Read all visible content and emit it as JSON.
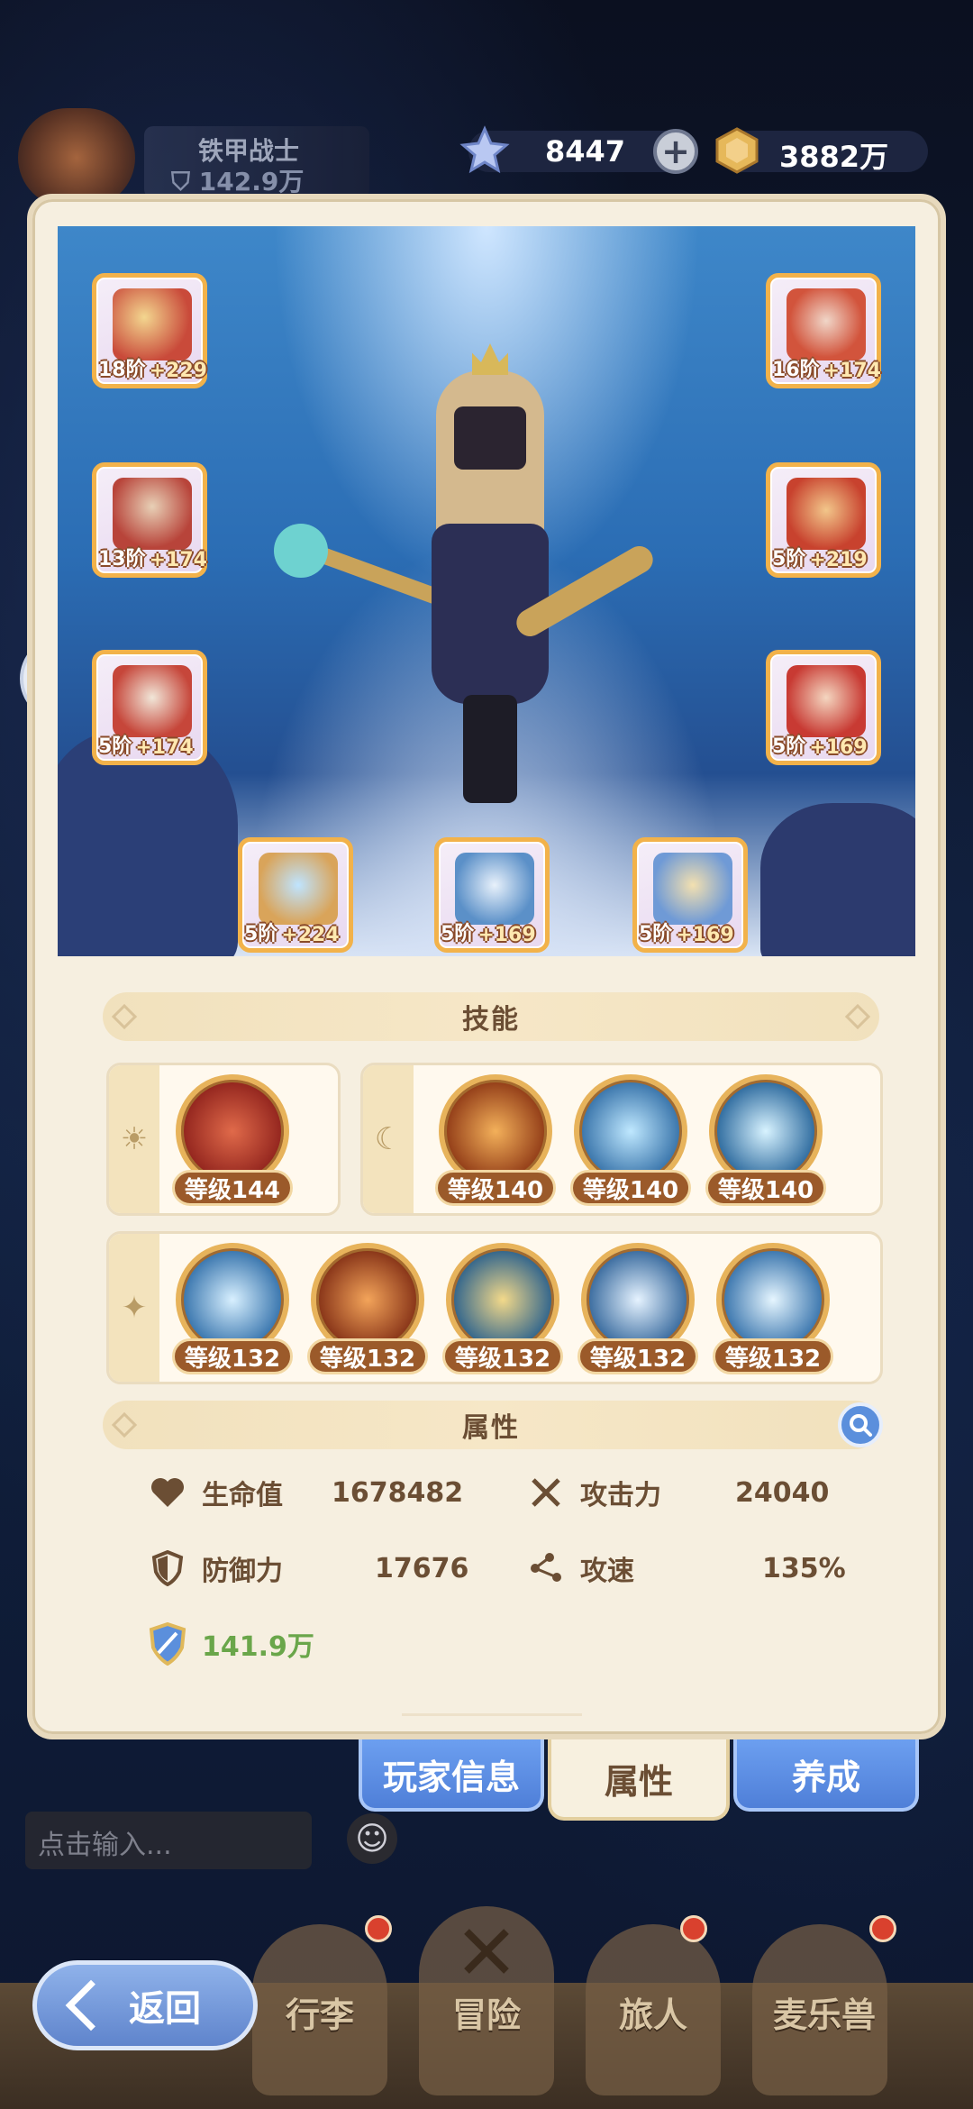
{
  "hud": {
    "player_name": "铁甲战士",
    "player_power": "142.9万",
    "star_currency": "8447",
    "coin_currency": "3882万"
  },
  "equipment": [
    {
      "id": "bow",
      "tier": "18阶",
      "bonus": "+229",
      "color": "#c94a3a"
    },
    {
      "id": "helmet",
      "tier": "16阶",
      "bonus": "+174",
      "color": "#d2543c"
    },
    {
      "id": "chest-armor",
      "tier": "13阶",
      "bonus": "+174",
      "color": "#b8443a"
    },
    {
      "id": "gauntlet",
      "tier": "5阶",
      "bonus": "+219",
      "color": "#c8422e"
    },
    {
      "id": "leg-armor",
      "tier": "5阶",
      "bonus": "+174",
      "color": "#c6463a"
    },
    {
      "id": "boots",
      "tier": "5阶",
      "bonus": "+169",
      "color": "#c83a33"
    },
    {
      "id": "ring",
      "tier": "5阶",
      "bonus": "+224",
      "color": "#5aa8e0"
    },
    {
      "id": "necklace",
      "tier": "5阶",
      "bonus": "+169",
      "color": "#5b90c8"
    },
    {
      "id": "charm",
      "tier": "5阶",
      "bonus": "+169",
      "color": "#6f9ad6"
    }
  ],
  "skills": {
    "header": "技能",
    "day_group": [
      {
        "name": "sun-archer-skill-icon",
        "level": "等级144",
        "color": "#c0392b"
      }
    ],
    "night_group": [
      {
        "name": "burst-skill-icon",
        "level": "等级140",
        "color": "#c0581e"
      },
      {
        "name": "target-hands-skill-icon",
        "level": "等级140",
        "color": "#d6a24a"
      },
      {
        "name": "comet-skill-icon",
        "level": "等级140",
        "color": "#2f8fc9"
      }
    ],
    "star_group": [
      {
        "name": "beast-skill-icon",
        "level": "等级132",
        "color": "#2f8fc9"
      },
      {
        "name": "fire-bow-skill-icon",
        "level": "等级132",
        "color": "#c0581e"
      },
      {
        "name": "castle-skill-icon",
        "level": "等级132",
        "color": "#2f7fb8"
      },
      {
        "name": "arrow-skill-icon",
        "level": "等级132",
        "color": "#3a7fc0"
      },
      {
        "name": "triple-arrow-skill-icon",
        "level": "等级132",
        "color": "#2f8fc9"
      }
    ]
  },
  "attributes": {
    "header": "属性",
    "hp_label": "生命值",
    "hp_value": "1678482",
    "atk_label": "攻击力",
    "atk_value": "24040",
    "def_label": "防御力",
    "def_value": "17676",
    "spd_label": "攻速",
    "spd_value": "135%",
    "power_value": "141.9万"
  },
  "tabs": {
    "player_info": "玩家信息",
    "attributes": "属性",
    "training": "养成"
  },
  "chat": {
    "placeholder": "点击输入..."
  },
  "nav": {
    "back": "返回",
    "luggage": "行李",
    "adventure": "冒险",
    "traveler": "旅人",
    "pet": "麦乐兽"
  }
}
